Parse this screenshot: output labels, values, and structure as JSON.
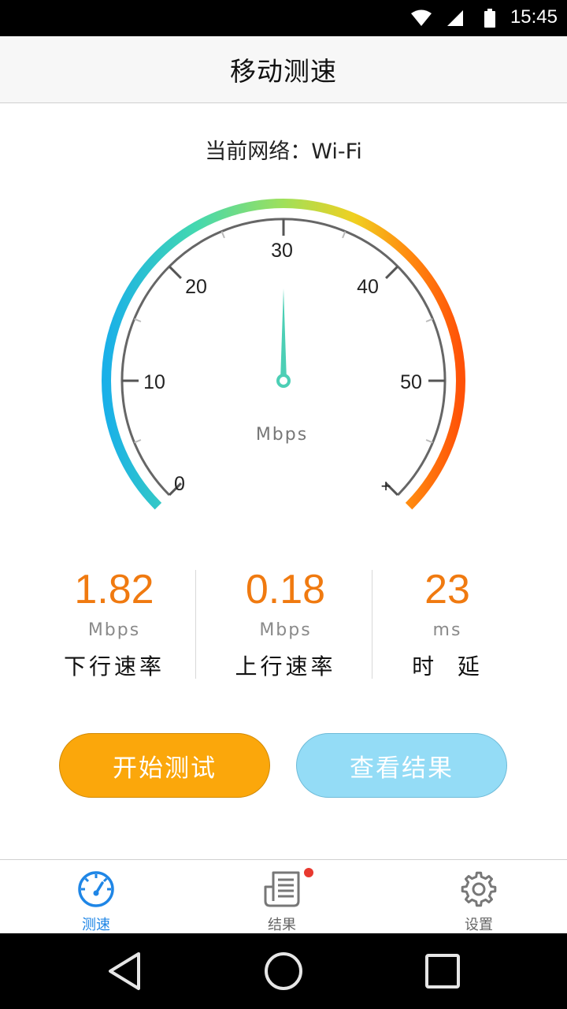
{
  "status_bar": {
    "time": "15:45",
    "icons": [
      "wifi-icon",
      "signal-icon",
      "battery-icon"
    ]
  },
  "title_bar": {
    "title": "移动测速"
  },
  "network": {
    "label": "当前网络：Wi-Fi"
  },
  "gauge": {
    "tick_labels": [
      "0",
      "10",
      "20",
      "30",
      "40",
      "50",
      "+"
    ],
    "unit": "Mbps",
    "needle_value": 30,
    "colors": {
      "start": "#1ab0e8",
      "mid": "#8be060",
      "end": "#ff5a0a",
      "needle": "#4ccfb5"
    }
  },
  "stats": [
    {
      "value": "1.82",
      "unit": "Mbps",
      "label": "下行速率"
    },
    {
      "value": "0.18",
      "unit": "Mbps",
      "label": "上行速率"
    },
    {
      "value": "23",
      "unit": "ms",
      "label": "时  延"
    }
  ],
  "buttons": {
    "start": "开始测试",
    "results": "查看结果"
  },
  "tabbar": {
    "tabs": [
      {
        "label": "测速",
        "icon": "speedometer-icon",
        "active": true
      },
      {
        "label": "结果",
        "icon": "document-icon",
        "active": false,
        "badge": true
      },
      {
        "label": "设置",
        "icon": "gear-icon",
        "active": false
      }
    ]
  },
  "navbar": {
    "buttons": [
      "back-icon",
      "home-icon",
      "recents-icon"
    ]
  },
  "colors": {
    "accent": "#f07a10",
    "tab_active": "#1f86e6",
    "start_button": "#fba70b",
    "result_button": "#94dcf6"
  }
}
